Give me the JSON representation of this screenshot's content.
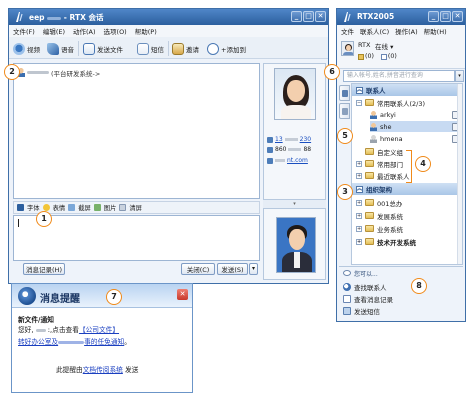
{
  "chat_window": {
    "title_prefix": "eep",
    "title_suffix": "- RTX 会话",
    "menu": [
      "文件(F)",
      "编辑(E)",
      "动作(A)",
      "选项(O)",
      "帮助(P)"
    ],
    "toolbar": {
      "video": "视频",
      "voice": "语音",
      "send_file": "发送文件",
      "sms": "短信",
      "invite": "邀请",
      "add_to": "+添加到"
    },
    "contact_line": "(平台研发系统->",
    "format_bar": [
      "字体",
      "表情",
      "截屏",
      "图片",
      "清屏"
    ],
    "history_button": "消息记录(H)",
    "close_button": "关闭(C)",
    "send_button": "发送(S)",
    "send_dropdown": "▾",
    "profile": {
      "phone_prefix": "13",
      "phone_suffix": "230",
      "tel_prefix": "860",
      "tel_suffix": "88",
      "web_suffix": "nt.com"
    },
    "splitter_glyph": "▾"
  },
  "rtx_window": {
    "title": "RTX2005",
    "menu": [
      "文件",
      "联系人(C)",
      "操作(A)",
      "帮助(H)"
    ],
    "user": {
      "name": "RTX",
      "status": "在线 ▾",
      "msg_count": "(0)",
      "mail_count": "(0)"
    },
    "search_placeholder": "输入帐号,姓名,拼音进行查询",
    "search_btn": "▾",
    "section_contacts": "联系人",
    "common_contacts": "常用联系人(2/3)",
    "contacts": [
      "arkyi",
      "she",
      "hmena"
    ],
    "custom_group": "自定义组",
    "common_dept": "常用部门",
    "recent_contacts": "最近联系人",
    "section_org": "组织架构",
    "org_items": [
      "001总办",
      "发展系统",
      "业务系统",
      "技术开发系统"
    ],
    "can_do": "您可以...",
    "actions": [
      "查找联系人",
      "查看消息记录",
      "发送短信"
    ]
  },
  "popup": {
    "title": "消息提醒",
    "line1": "新文件/通知",
    "line2_prefix": "您好,",
    "line2_mid": ":,点击查看",
    "line2_link": "【公司文件】",
    "line3_a": "转好办公室及",
    "line3_b": "事的任免通知",
    "line3_end": "。",
    "line4_prefix": "此提醒由",
    "line4_link": "文档传阅系统",
    "line4_suffix": "发送",
    "close_glyph": "✕"
  },
  "window_buttons": {
    "min": "_",
    "max": "□",
    "close": "✕"
  },
  "callouts": [
    "1",
    "2",
    "3",
    "4",
    "5",
    "6",
    "7",
    "8"
  ]
}
